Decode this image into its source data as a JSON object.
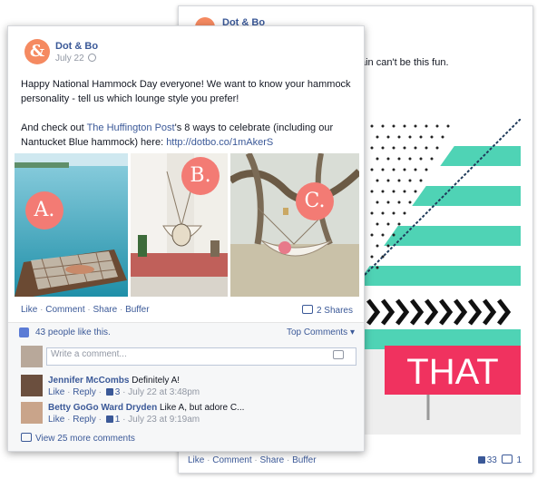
{
  "back_post": {
    "page_name": "Dot & Bo",
    "text_fragment": "ain can't be this fun.",
    "image_caption": "THAT",
    "footer": {
      "like": "Like",
      "comment": "Comment",
      "share": "Share",
      "buffer": "Buffer"
    },
    "like_count": "33",
    "comment_count": "1"
  },
  "post": {
    "page_name": "Dot & Bo",
    "date": "July 22",
    "paragraph1": "Happy National Hammock Day everyone! We want to know your hammock personality - tell us which lounge style you prefer!",
    "paragraph2_before": "And check out ",
    "paragraph2_link": "The Huffington Post",
    "paragraph2_after": "'s 8 ways to celebrate (including our Nantucket Blue hammock) here: ",
    "paragraph2_url": "http://dotbo.co/1mAkerS",
    "photos": [
      {
        "badge": "A."
      },
      {
        "badge": "B."
      },
      {
        "badge": "C."
      }
    ],
    "actions": {
      "like": "Like",
      "comment": "Comment",
      "share": "Share",
      "buffer": "Buffer"
    },
    "shares": "2 Shares",
    "likes_text": "43 people like this.",
    "top_comments": "Top Comments",
    "comment_placeholder": "Write a comment...",
    "comments": [
      {
        "author": "Jennifer McCombs",
        "text": "Definitely A!",
        "like": "Like",
        "reply": "Reply",
        "likes": "3",
        "time": "July 22 at 3:48pm"
      },
      {
        "author": "Betty GoGo Ward Dryden",
        "text": "Like A, but adore C...",
        "like": "Like",
        "reply": "Reply",
        "likes": "1",
        "time": "July 23 at 9:19am"
      }
    ],
    "more_comments": "View 25 more comments"
  },
  "colors": {
    "link": "#3b5998",
    "brand_orange": "#f58a61",
    "badge_coral": "#f37b74",
    "that_pink": "#f0325f",
    "mint": "#4fd3b5"
  }
}
